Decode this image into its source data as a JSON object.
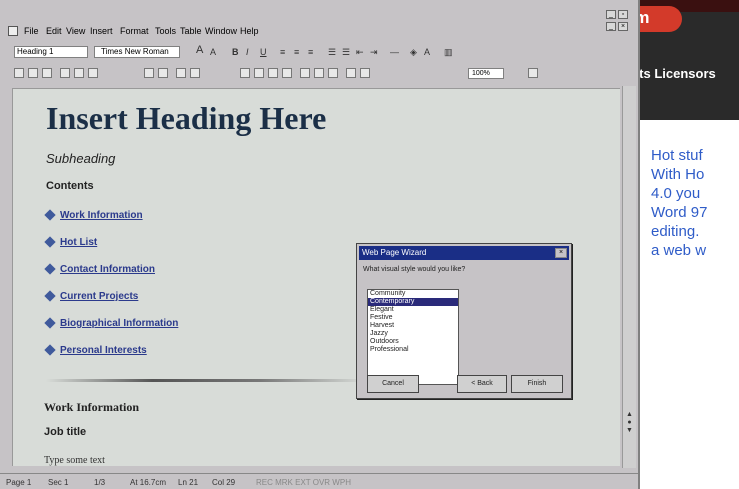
{
  "menu": [
    "File",
    "Edit",
    "View",
    "Insert",
    "Format",
    "Tools",
    "Table",
    "Window",
    "Help"
  ],
  "format_toolbar": {
    "style": "Heading 1",
    "font": "Times New Roman"
  },
  "standard_toolbar": {
    "zoom": "100%"
  },
  "document": {
    "heading": "Insert Heading Here",
    "subheading": "Subheading",
    "contents_label": "Contents",
    "links": [
      "Work Information",
      "Hot List",
      "Contact Information",
      "Current Projects",
      "Biographical Information",
      "Personal Interests"
    ],
    "section_heading": "Work Information",
    "job_title": "Job title",
    "body_text": "Type some text"
  },
  "statusbar": {
    "page": "Page 1",
    "sec": "Sec 1",
    "of": "1/3",
    "at": "At 16.7cm",
    "ln": "Ln 21",
    "col": "Col 29",
    "modes": "REC  MRK  EXT  OVR  WPH"
  },
  "wizard": {
    "title": "Web Page Wizard",
    "question": "What visual style would you like?",
    "styles": [
      "Community",
      "Contemporary",
      "Elegant",
      "Festive",
      "Harvest",
      "Jazzy",
      "Outdoors",
      "Professional"
    ],
    "selected_index": 1,
    "cancel": "Cancel",
    "back": "< Back",
    "finish": "Finish"
  },
  "side_panel": {
    "logo_text": "om",
    "licensors": "n Its Licensors",
    "text": "Hot stuf\nWith Ho\n4.0 you\nWord 97\nediting.\na web w"
  }
}
